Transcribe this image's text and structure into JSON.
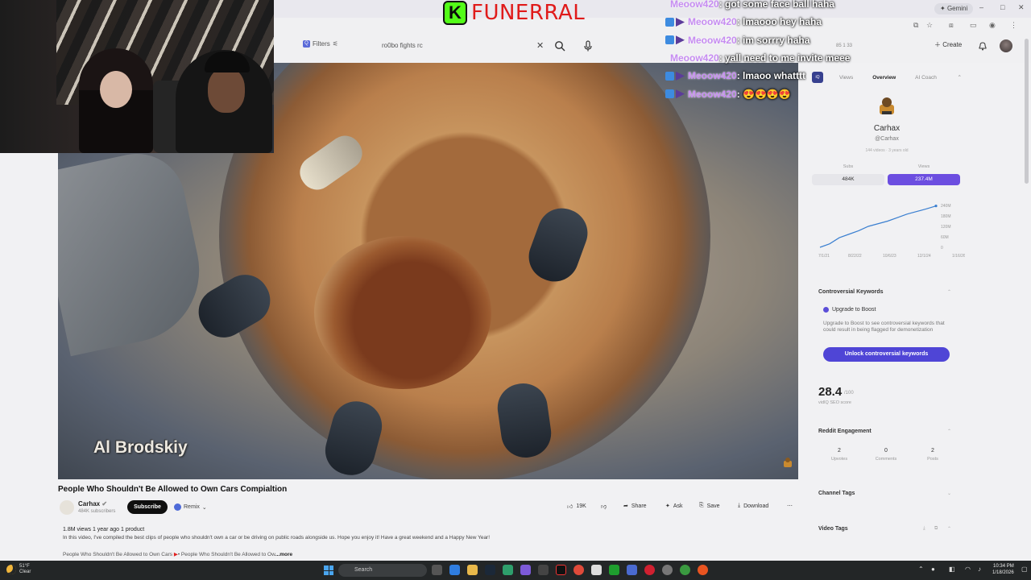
{
  "browser": {
    "gemini_label": "Gemini",
    "window_controls": [
      "–",
      "□",
      "✕"
    ]
  },
  "header": {
    "filters_label": "Filters",
    "search_value": "ro0bo fights rc",
    "channel_stats": "85  1  33",
    "create_label": "Create"
  },
  "stream": {
    "title_text": "FUNERRAL",
    "logo_letter": "K",
    "chat": [
      {
        "user": "Meoow420",
        "message": " : got some face ball haha"
      },
      {
        "user": "Meoow420",
        "message": " : lmaooo hey haha"
      },
      {
        "user": "Meoow420",
        "message": " : im sorrry haha"
      },
      {
        "user": "Meoow420",
        "message": " : yall need to me invite meee"
      },
      {
        "user": "Meoow420",
        "message": " : lmaoo whatttt"
      },
      {
        "user": "Meoow420",
        "message": " : 😍😍😍😍"
      }
    ]
  },
  "video": {
    "watermark": "Al Brodskiy",
    "title": "People Who Shouldn't Be Allowed to Own Cars Compialtion",
    "channel_name": "Carhax",
    "channel_subs": "484K subscribers",
    "subscribe_label": "Subscribe",
    "remix_label": "Remix",
    "actions": {
      "likes": "19K",
      "share": "Share",
      "ask": "Ask",
      "save": "Save",
      "download": "Download"
    },
    "description": {
      "meta": "1.8M views  1 year ago  1 product",
      "text": "In this video, I've compiled the best clips of people who shouldn't own a car or be driving on public roads alongside us. Hope you enjoy it! Have a great weekend and a Happy New Year!",
      "preview": "People Who Shouldn't Be Allowed to Own Cars",
      "preview2": "• People Who Shouldn't Be Allowed to Ow",
      "more": "...more"
    }
  },
  "panel": {
    "logo": "iQ",
    "tabs": [
      "Views",
      "Overview",
      "AI Coach"
    ],
    "active_tab": "Overview",
    "channel_name": "Carhax",
    "channel_handle": "@Carhax",
    "channel_meta": "144 videos · 3 years old",
    "subs_label": "Subs",
    "subs_value": "484K",
    "views_label": "Views",
    "views_value": "237.4M",
    "accent": "#6c4ee0",
    "keywords_title": "Controversial Keywords",
    "upgrade_title": "Upgrade to Boost",
    "upgrade_desc": "Upgrade to Boost to see controversial keywords that could result in being flagged for demonetization",
    "unlock_label": "Unlock controversial keywords",
    "seo_score": "28.4",
    "seo_max": "/100",
    "seo_label": "vidIQ SEO score",
    "reddit_title": "Reddit Engagement",
    "reddit": [
      {
        "value": "2",
        "label": "Upvotes"
      },
      {
        "value": "0",
        "label": "Comments"
      },
      {
        "value": "2",
        "label": "Posts"
      }
    ],
    "channel_tags_title": "Channel Tags",
    "video_tags_title": "Video Tags"
  },
  "chart_data": {
    "type": "line",
    "x": [
      "7/1/21",
      "8/22/22",
      "10/6/23",
      "12/1/24",
      "1/16/26"
    ],
    "ylim": [
      0,
      240
    ],
    "y_ticks": [
      "240M",
      "180M",
      "120M",
      "60M",
      "0"
    ],
    "series": [
      {
        "values": [
          0,
          20,
          55,
          75,
          95,
          120,
          135,
          150,
          170,
          190,
          205,
          220,
          237
        ]
      }
    ]
  },
  "taskbar": {
    "temp": "51°F",
    "condition": "Clear",
    "search_label": "Search",
    "time": "10:34 PM",
    "date": "1/18/2026"
  }
}
